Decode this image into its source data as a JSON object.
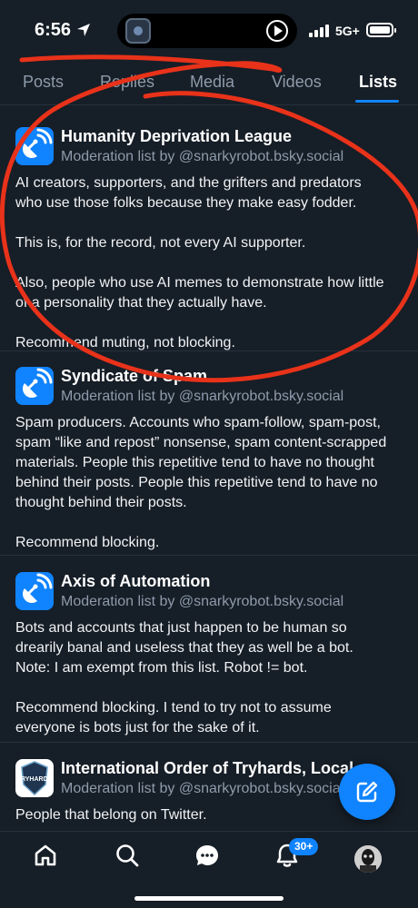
{
  "status_bar": {
    "time": "6:56",
    "network": "5G+"
  },
  "tabs": [
    {
      "label": "Posts",
      "active": false
    },
    {
      "label": "Replies",
      "active": false
    },
    {
      "label": "Media",
      "active": false
    },
    {
      "label": "Videos",
      "active": false
    },
    {
      "label": "Lists",
      "active": true
    }
  ],
  "lists": [
    {
      "title": "Humanity Deprivation League",
      "subtitle": "Moderation list by @snarkyrobot.bsky.social",
      "description": "AI creators, supporters, and the grifters and predators who use those folks because they make easy fodder.\n\nThis is, for the record, not every AI supporter.\n\nAlso, people who use AI memes to demonstrate how little of a personality that they actually have.\n\nRecommend muting, not blocking.",
      "avatar": "satellite-dish-icon"
    },
    {
      "title": "Syndicate of Spam",
      "subtitle": "Moderation list by @snarkyrobot.bsky.social",
      "description": "Spam producers. Accounts who spam-follow, spam-post, spam “like and repost” nonsense, spam content-scrapped materials. People this repetitive tend to have no thought behind their posts. People this repetitive tend to have no thought behind their posts.\n\nRecommend blocking.",
      "avatar": "satellite-dish-icon"
    },
    {
      "title": "Axis of Automation",
      "subtitle": "Moderation list by @snarkyrobot.bsky.social",
      "description": "Bots and accounts that just happen to be human so drearily banal and useless that they as well be a bot. Note: I am exempt from this list. Robot != bot.\n\nRecommend blocking. I tend to try not to assume everyone is bots just for the sake of it.",
      "avatar": "satellite-dish-icon"
    },
    {
      "title": "International Order of Tryhards, Local…",
      "subtitle": "Moderation list by @snarkyrobot.bsky.social",
      "description": "People that belong on Twitter.",
      "avatar": "tryhards-logo",
      "logo_text": "TRYHARDS"
    }
  ],
  "bottom_nav": {
    "notifications_badge": "30+"
  },
  "colors": {
    "background": "#161e27",
    "accent": "#1083fe",
    "secondary_text": "#8e9bab",
    "annotation": "#e8321a"
  }
}
